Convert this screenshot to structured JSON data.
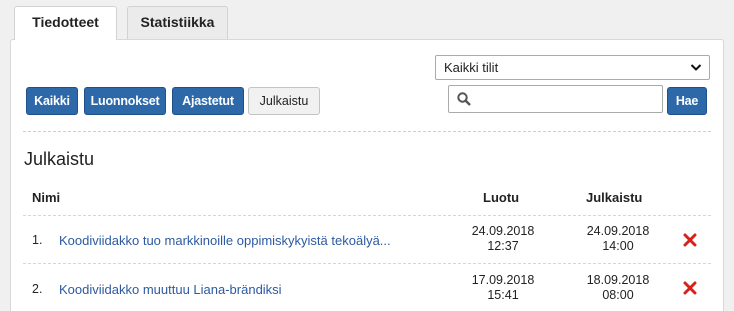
{
  "tabs": [
    {
      "label": "Tiedotteet",
      "active": true
    },
    {
      "label": "Statistiikka",
      "active": false
    }
  ],
  "filters": {
    "all": "Kaikki",
    "drafts": "Luonnokset",
    "scheduled": "Ajastetut",
    "published": "Julkaistu"
  },
  "account_select": {
    "value": "Kaikki tilit"
  },
  "search": {
    "placeholder": "",
    "button": "Hae"
  },
  "section_title": "Julkaistu",
  "table": {
    "headers": {
      "name": "Nimi",
      "created": "Luotu",
      "published": "Julkaistu"
    },
    "rows": [
      {
        "num": "1.",
        "title": "Koodiviidakko tuo markkinoille oppimiskykyistä tekoälyä...",
        "created_date": "24.09.2018",
        "created_time": "12:37",
        "published_date": "24.09.2018",
        "published_time": "14:00"
      },
      {
        "num": "2.",
        "title": "Koodiviidakko muuttuu Liana-brändiksi",
        "created_date": "17.09.2018",
        "created_time": "15:41",
        "published_date": "18.09.2018",
        "published_time": "08:00"
      }
    ]
  },
  "colors": {
    "primary": "#2d69a9",
    "link": "#2c5aa0",
    "delete": "#d9201a"
  }
}
